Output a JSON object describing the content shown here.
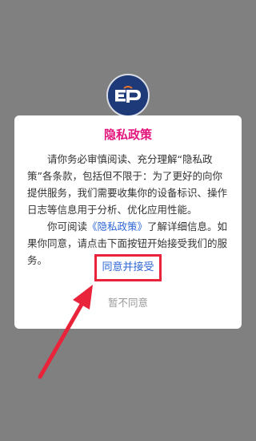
{
  "background_color": "#808080",
  "accent_color": "#e3157d",
  "link_color": "#2e66d6",
  "annotation_color": "#e8233a",
  "app_logo": {
    "icon": "ep-logo-icon",
    "text": "EP"
  },
  "dialog": {
    "title": "隐私政策",
    "paragraph1": "请你务必审慎阅读、充分理解“隐私政策”各条款，包括但不限于：为了更好的向你提供服务，我们需要收集你的设备标识、操作日志等信息用于分析、优化应用性能。",
    "paragraph2_before": "你可阅读",
    "paragraph2_link": "《隐私政策》",
    "paragraph2_after": "了解详细信息。如果你同意，请点击下面按钮开始接受我们的服务。",
    "agree_label": "同意并接受",
    "disagree_label": "暂不同意"
  },
  "annotation": {
    "type": "red-arrow",
    "target": "agree-button"
  }
}
